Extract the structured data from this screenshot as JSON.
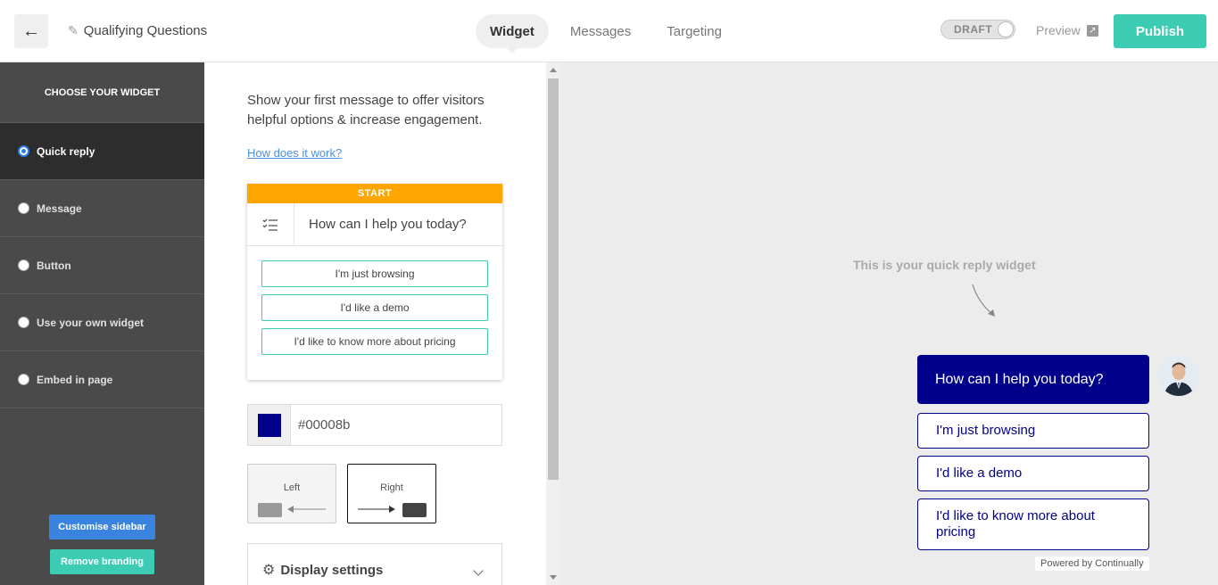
{
  "header": {
    "back_icon": "arrow-left-icon",
    "title": "Qualifying Questions",
    "tabs": [
      {
        "label": "Widget",
        "active": true
      },
      {
        "label": "Messages",
        "active": false
      },
      {
        "label": "Targeting",
        "active": false
      }
    ],
    "draft_label": "DRAFT",
    "preview_label": "Preview",
    "publish_label": "Publish"
  },
  "sidebar": {
    "heading": "CHOOSE YOUR WIDGET",
    "items": [
      {
        "label": "Quick reply",
        "selected": true
      },
      {
        "label": "Message",
        "selected": false
      },
      {
        "label": "Button",
        "selected": false
      },
      {
        "label": "Use your own widget",
        "selected": false
      },
      {
        "label": "Embed in page",
        "selected": false
      }
    ],
    "customise_label": "Customise sidebar",
    "branding_label": "Remove branding"
  },
  "panel": {
    "intro": "Show your first message to offer visitors helpful options & increase engagement.",
    "how_link": "How does it work?",
    "card": {
      "start_label": "START",
      "question": "How can I help you today?",
      "options": [
        "I'm just browsing",
        "I'd like a demo",
        "I'd like to know more about pricing"
      ]
    },
    "color_value": "#00008b",
    "position": {
      "left_label": "Left",
      "right_label": "Right",
      "selected": "Right"
    },
    "display_settings_label": "Display settings"
  },
  "preview": {
    "hint": "This is your quick reply widget",
    "question": "How can I help you today?",
    "options": [
      "I'm just browsing",
      "I'd like a demo",
      "I'd like to know more about pricing"
    ],
    "powered_by": "Powered by Continually"
  },
  "colors": {
    "brand_teal": "#3cccb4",
    "widget_color": "#00008b",
    "start_orange": "#ffa500",
    "customise_blue": "#3a84e0"
  }
}
